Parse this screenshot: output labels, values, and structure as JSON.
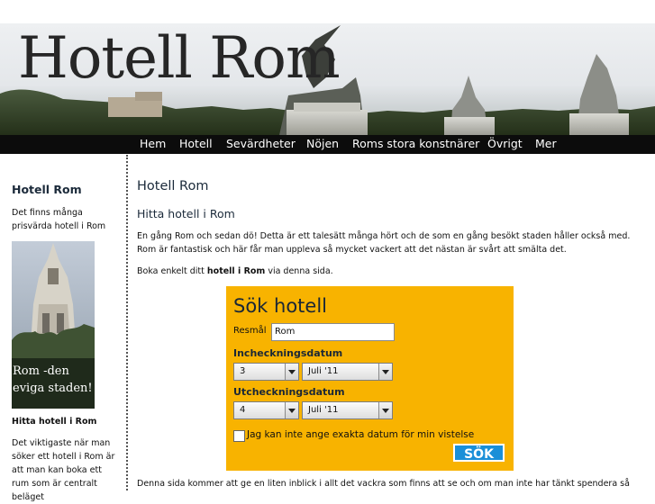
{
  "header": {
    "title": "Hotell Rom"
  },
  "nav": [
    {
      "label": "Hem"
    },
    {
      "label": "Hotell"
    },
    {
      "label": "Sevärdheter"
    },
    {
      "label": "Nöjen"
    },
    {
      "label": "Roms stora konstnärer"
    },
    {
      "label": "Övrigt"
    },
    {
      "label": "Mer"
    }
  ],
  "sidebar": {
    "heading": "Hotell Rom",
    "intro": "Det finns många prisvärda hotell i Rom",
    "photo_caption": "Rom -den eviga staden!",
    "subheading": "Hitta hotell i Rom",
    "text": "Det viktigaste när man söker ett hotell i Rom är att man kan boka ett rum som är centralt beläget"
  },
  "main": {
    "title": "Hotell Rom",
    "subtitle": "Hitta hotell i Rom",
    "para1": "En gång Rom och sedan dö! Detta är ett talesätt många hört och de som en gång besökt staden håller också med. Rom är fantastisk och här får man uppleva så mycket vackert att det nästan är svårt att smälta det.",
    "para2_pre": "Boka enkelt ditt ",
    "para2_bold": "hotell i Rom",
    "para2_post": " via denna sida.",
    "para3": "Denna sida kommer att ge en liten inblick i allt det vackra som finns att se och om man inte har tänkt spendera så"
  },
  "search": {
    "title": "Sök hotell",
    "dest_label": "Resmål",
    "dest_value": "Rom",
    "checkin_label": "Incheckningsdatum",
    "checkin_day": "3",
    "checkin_month": "Juli '11",
    "checkout_label": "Utcheckningsdatum",
    "checkout_day": "4",
    "checkout_month": "Juli '11",
    "flexible_label": "Jag kan inte ange exakta datum för min vistelse",
    "submit_label": "SÖK"
  },
  "colors": {
    "nav_bg": "#0c0c0c",
    "search_bg": "#f8b300",
    "submit_bg": "#1a8fd8"
  }
}
